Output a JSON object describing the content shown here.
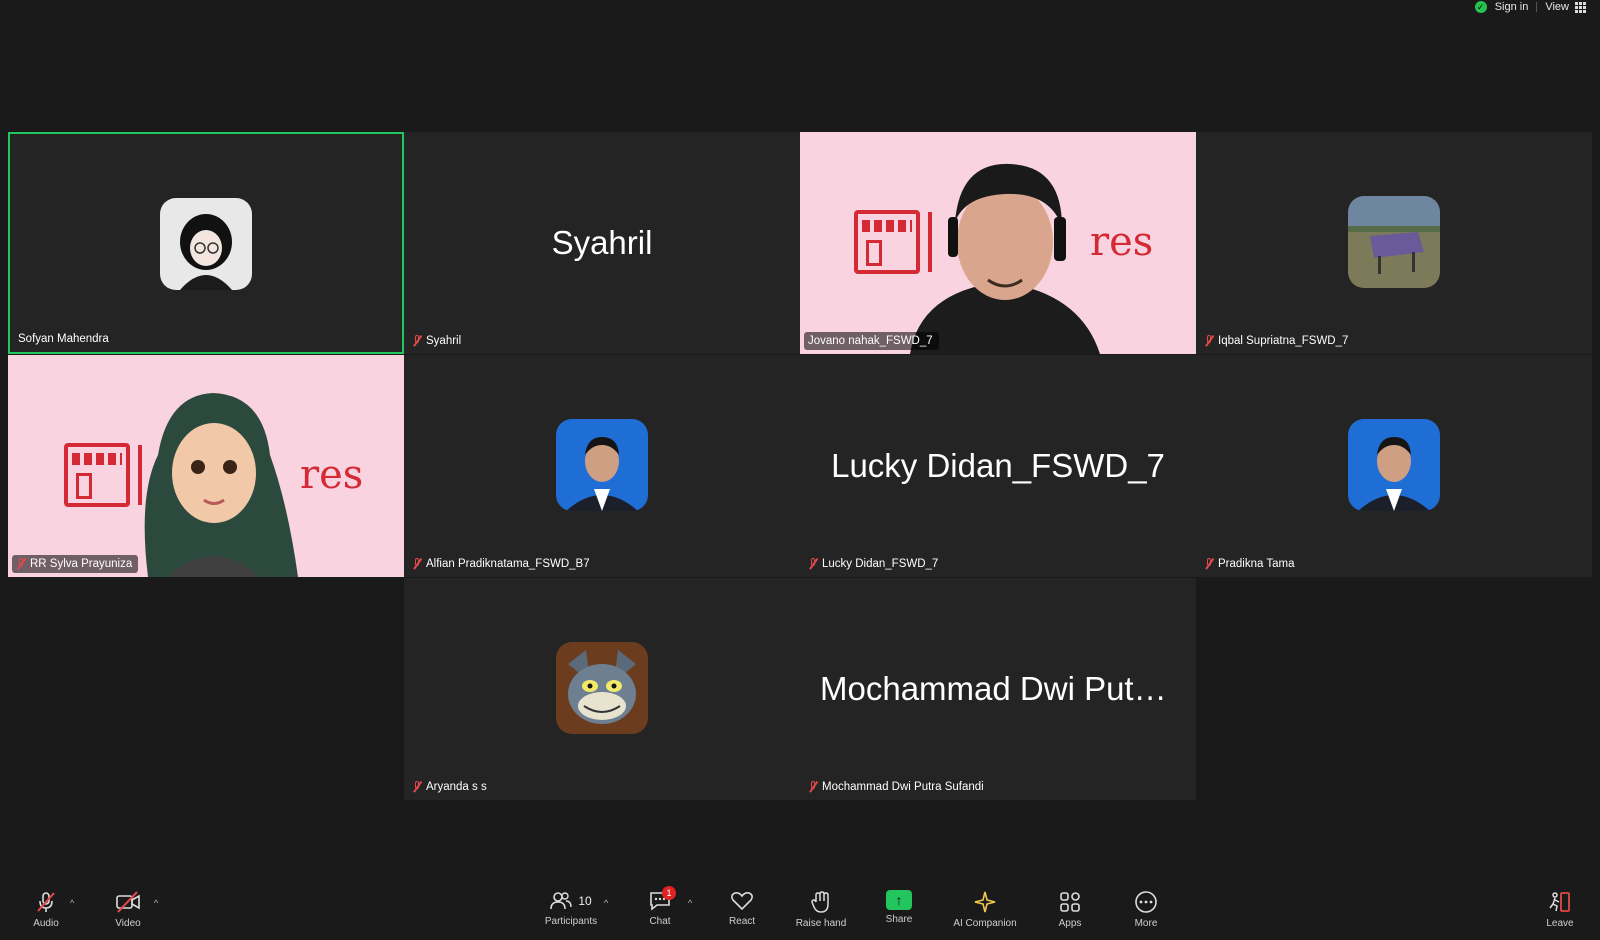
{
  "topbar": {
    "signin": "Sign in",
    "view": "View"
  },
  "tiles": [
    {
      "name": "Sofyan Mahendra"
    },
    {
      "name": "Syahril",
      "display": "Syahril"
    },
    {
      "name": "Jovano nahak_FSWD_7",
      "logo_text": "res"
    },
    {
      "name": "Iqbal Supriatna_FSWD_7"
    },
    {
      "name": "RR Sylva Prayuniza",
      "logo_text": "res"
    },
    {
      "name": "Alfian Pradiknatama_FSWD_B7"
    },
    {
      "name": "Lucky Didan_FSWD_7",
      "display": "Lucky Didan_FSWD_7"
    },
    {
      "name": "Pradikna Tama"
    },
    {
      "name": "Aryanda s s"
    },
    {
      "name": "Mochammad Dwi Putra Sufandi",
      "display": "Mochammad Dwi Putra..."
    }
  ],
  "toolbar": {
    "audio": "Audio",
    "video": "Video",
    "participants": "Participants",
    "participants_count": "10",
    "chat": "Chat",
    "chat_badge": "1",
    "react": "React",
    "raise_hand": "Raise hand",
    "share": "Share",
    "ai_companion": "AI Companion",
    "apps": "Apps",
    "more": "More",
    "leave": "Leave"
  },
  "colors": {
    "active_border": "#22c55e",
    "muted_red": "#e54848",
    "share_green": "#22c55e",
    "tile_bg": "#242424",
    "pink_bg": "#f9d3e0"
  }
}
